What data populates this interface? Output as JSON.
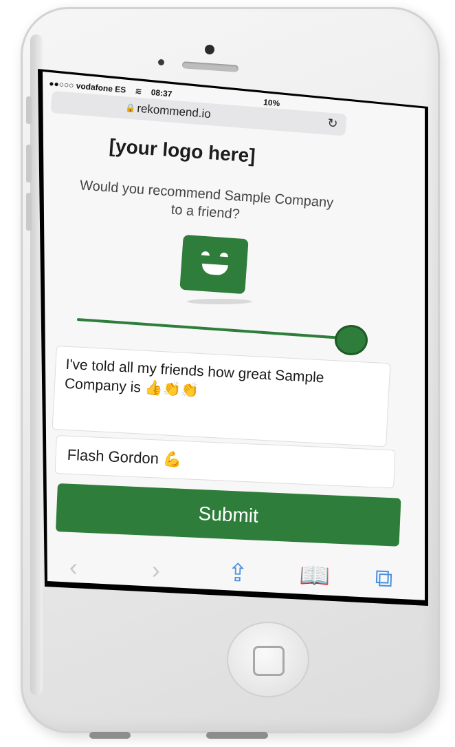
{
  "statusbar": {
    "carrier": "●●○○○ vodafone ES",
    "time": "08:37",
    "battery": "10%"
  },
  "browser": {
    "url": "rekommend.io"
  },
  "survey": {
    "logo": "[your logo here]",
    "question": "Would you recommend Sample Company to a friend?",
    "rating_fraction": 1.0,
    "feedback_value": "I've told all my friends how great Sample Company is 👍👏👏",
    "name_value": "Flash Gordon 💪",
    "submit_label": "Submit"
  },
  "icons": {
    "back": "‹",
    "forward": "›",
    "share": "⇪",
    "bookmarks": "📖",
    "tabs": "⧉",
    "lock": "🔒",
    "reload": "↻"
  },
  "colors": {
    "brand": "#2e7d3a",
    "ios_blue": "#4a90e2"
  }
}
